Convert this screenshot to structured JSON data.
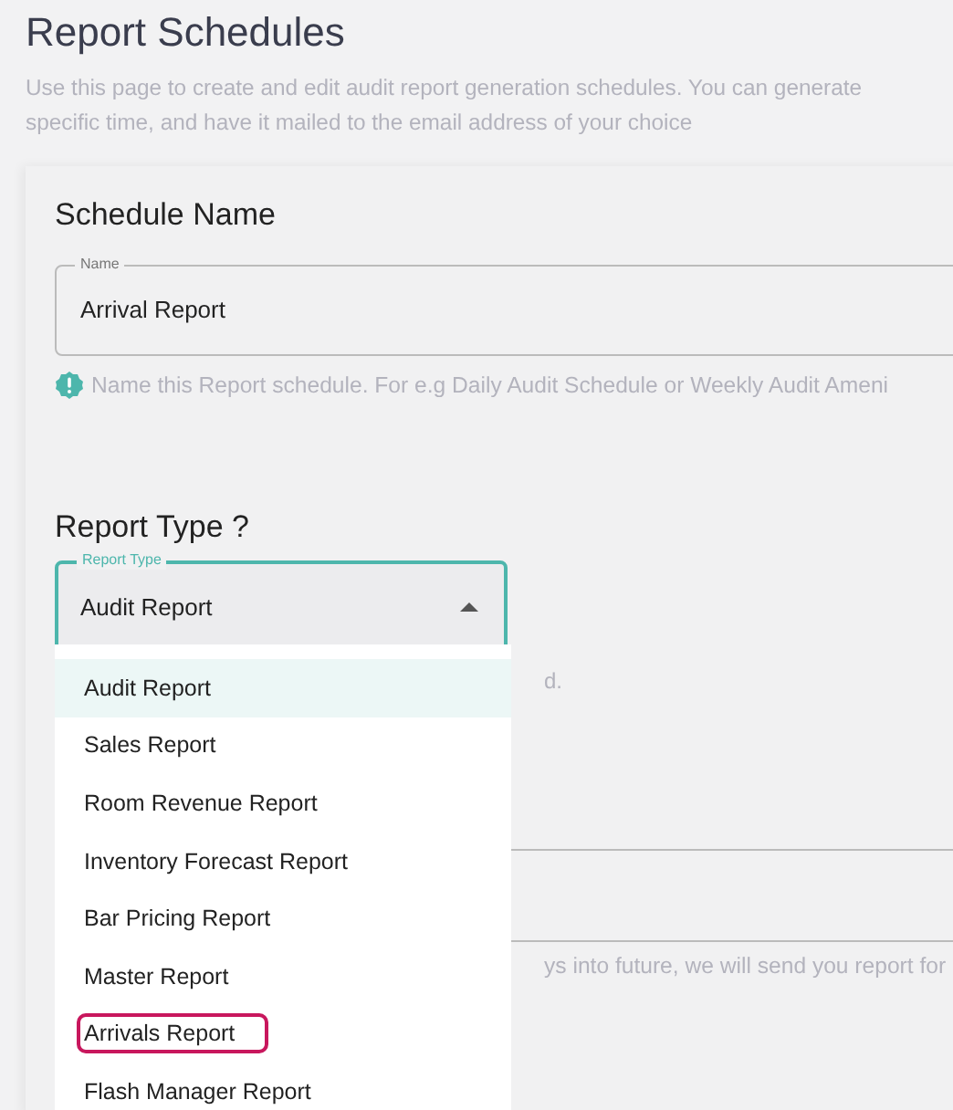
{
  "page": {
    "title": "Report Schedules",
    "description_lines": [
      "Use this page to create and edit audit report generation schedules. You can generate",
      "specific time, and have it mailed to the email address of your choice"
    ]
  },
  "schedule_name": {
    "heading": "Schedule Name",
    "field": {
      "label": "Name",
      "value": "Arrival Report"
    },
    "hint": "Name this Report schedule. For e.g Daily Audit Schedule or Weekly Audit Ameni"
  },
  "report_type": {
    "heading": "Report Type ?",
    "select": {
      "label": "Report Type",
      "value": "Audit Report",
      "expanded": true
    },
    "hidden_hint": "d.",
    "future_hint": "ys into future, we will send you report for",
    "options": [
      {
        "label": "Audit Report",
        "selected": true,
        "highlighted": false
      },
      {
        "label": "Sales Report",
        "selected": false,
        "highlighted": false
      },
      {
        "label": "Room Revenue Report",
        "selected": false,
        "highlighted": false
      },
      {
        "label": "Inventory Forecast Report",
        "selected": false,
        "highlighted": false
      },
      {
        "label": "Bar Pricing Report",
        "selected": false,
        "highlighted": false
      },
      {
        "label": "Master Report",
        "selected": false,
        "highlighted": false
      },
      {
        "label": "Arrivals Report",
        "selected": false,
        "highlighted": true
      },
      {
        "label": "Flash Manager Report",
        "selected": false,
        "highlighted": false
      }
    ]
  }
}
